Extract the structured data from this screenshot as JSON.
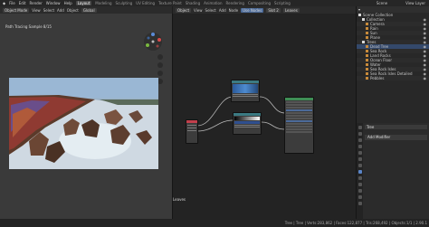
{
  "topbar": {
    "menus": [
      "File",
      "Edit",
      "Render",
      "Window",
      "Help"
    ],
    "workspaces": [
      "Layout",
      "Modeling",
      "Sculpting",
      "UV Editing",
      "Texture Paint",
      "Shading",
      "Animation",
      "Rendering",
      "Compositing",
      "Scripting"
    ],
    "active_workspace": "Layout",
    "scene": "Scene",
    "view_layer": "View Layer"
  },
  "viewport": {
    "mode": "Object Mode",
    "view": "View",
    "select": "Select",
    "add": "Add",
    "object": "Object",
    "global": "Global",
    "info": "Path Tracing Sample 8/15"
  },
  "node_editor": {
    "object": "Object",
    "view": "View",
    "select": "Select",
    "add": "Add",
    "node": "Node",
    "use_nodes": "Use Nodes",
    "slot": "Slot 2",
    "material": "Leaves",
    "label": "Leaves"
  },
  "outliner": {
    "title": "Scene Collection",
    "items": [
      {
        "label": "Collection",
        "color": "#d8d8d8",
        "sel": false
      },
      {
        "label": "Camera",
        "color": "#c88a3a",
        "sel": false
      },
      {
        "label": "Rain",
        "color": "#c88a3a",
        "sel": false
      },
      {
        "label": "Sun",
        "color": "#c88a3a",
        "sel": false
      },
      {
        "label": "Plane",
        "color": "#c88a3a",
        "sel": false
      },
      {
        "label": "Trees",
        "color": "#d8d8d8",
        "sel": false
      },
      {
        "label": "Dead Tree",
        "color": "#c88a3a",
        "sel": true
      },
      {
        "label": "Sea Rock",
        "color": "#c88a3a",
        "sel": false
      },
      {
        "label": "Land Rocks",
        "color": "#c88a3a",
        "sel": false
      },
      {
        "label": "Ocean Floor",
        "color": "#c88a3a",
        "sel": false
      },
      {
        "label": "Water",
        "color": "#c88a3a",
        "sel": false
      },
      {
        "label": "Sea Rock Isles",
        "color": "#c88a3a",
        "sel": false
      },
      {
        "label": "Sea Rock Isles Detailed",
        "color": "#c88a3a",
        "sel": false
      },
      {
        "label": "Pebbles",
        "color": "#c88a3a",
        "sel": false
      }
    ]
  },
  "properties": {
    "object": "Tree",
    "add_modifier": "Add Modifier"
  },
  "status": {
    "text": "Tree | Tree | Verts:283,862 | Faces:122,877 | Tris:268,492 | Objects:1/1 | 2.90.1"
  }
}
